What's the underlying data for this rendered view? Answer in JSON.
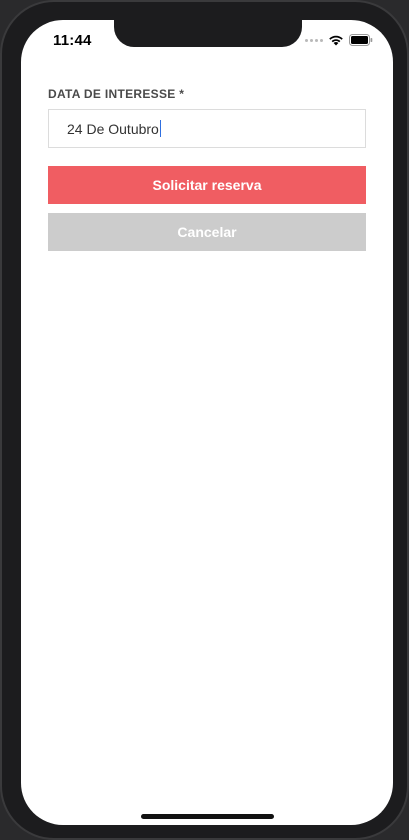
{
  "status_bar": {
    "time": "11:44"
  },
  "form": {
    "date_label": "DATA DE INTERESSE *",
    "date_value": "24 De Outubro"
  },
  "actions": {
    "submit_label": "Solicitar reserva",
    "cancel_label": "Cancelar"
  },
  "colors": {
    "primary": "#f05d62",
    "secondary": "#cccccc",
    "caret": "#2f6fe0"
  }
}
